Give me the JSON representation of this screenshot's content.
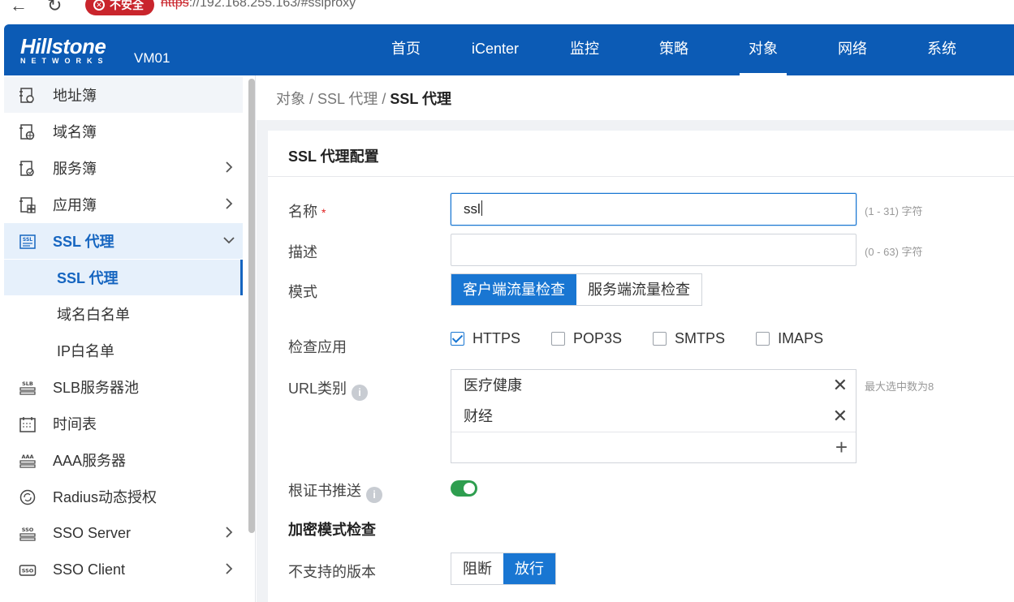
{
  "browser": {
    "back_icon": "arrow-left-icon",
    "reload_icon": "reload-icon",
    "security_label": "不安全",
    "url_scheme": "https",
    "url_rest": "://192.168.255.163/#sslproxy"
  },
  "header": {
    "brand": "Hillstone",
    "brand_sub": "NETWORKS",
    "device": "VM01",
    "nav": [
      "首页",
      "iCenter",
      "监控",
      "策略",
      "对象",
      "网络",
      "系统"
    ],
    "active_nav": "对象",
    "bg_color": "#0c5bb5"
  },
  "sidebar": {
    "items": [
      {
        "label": "地址簿",
        "icon": "address-book-icon"
      },
      {
        "label": "域名簿",
        "icon": "domain-book-icon"
      },
      {
        "label": "服务簿",
        "icon": "service-book-icon"
      },
      {
        "label": "应用簿",
        "icon": "app-book-icon"
      },
      {
        "label": "SSL 代理",
        "icon": "ssl-icon"
      },
      {
        "label": "SSL 代理"
      },
      {
        "label": "域名白名单"
      },
      {
        "label": "IP白名单"
      },
      {
        "label": "SLB服务器池",
        "icon": "slb-icon"
      },
      {
        "label": "时间表",
        "icon": "calendar-icon"
      },
      {
        "label": "AAA服务器",
        "icon": "aaa-server-icon"
      },
      {
        "label": "Radius动态授权",
        "icon": "radius-icon"
      },
      {
        "label": "SSO Server",
        "icon": "sso-server-icon"
      },
      {
        "label": "SSO Client",
        "icon": "sso-client-icon"
      }
    ]
  },
  "breadcrumb": {
    "parts": "对象 / SSL 代理 / ",
    "current": "SSL 代理"
  },
  "form": {
    "title": "SSL 代理配置",
    "name": {
      "label": "名称",
      "required": "*",
      "value": "ssl",
      "hint": "(1 - 31) 字符"
    },
    "desc": {
      "label": "描述",
      "value": "",
      "hint": "(0 - 63) 字符"
    },
    "mode": {
      "label": "模式",
      "options": [
        "客户端流量检查",
        "服务端流量检查"
      ],
      "selected": "客户端流量检查"
    },
    "check_apps": {
      "label": "检查应用",
      "options": [
        {
          "label": "HTTPS",
          "checked": true
        },
        {
          "label": "POP3S",
          "checked": false
        },
        {
          "label": "SMTPS",
          "checked": false
        },
        {
          "label": "IMAPS",
          "checked": false
        }
      ]
    },
    "url_category": {
      "label": "URL类别",
      "items": [
        "医疗健康",
        "财经"
      ],
      "hint": "最大选中数为8",
      "remove_icon": "close-icon",
      "add_icon": "plus-icon"
    },
    "root_cert_push": {
      "label": "根证书推送",
      "enabled": true,
      "color": "#2e9e4f"
    },
    "encrypt_section": "加密模式检查",
    "unsupported_version": {
      "label": "不支持的版本",
      "options": [
        "阻断",
        "放行"
      ],
      "selected": "放行"
    }
  }
}
